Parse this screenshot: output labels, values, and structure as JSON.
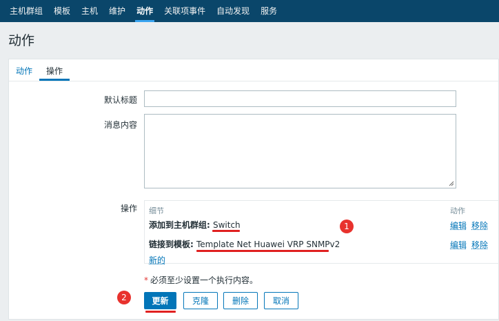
{
  "nav": {
    "items": [
      {
        "label": "主机群组",
        "active": false
      },
      {
        "label": "模板",
        "active": false
      },
      {
        "label": "主机",
        "active": false
      },
      {
        "label": "维护",
        "active": false
      },
      {
        "label": "动作",
        "active": true
      },
      {
        "label": "关联项事件",
        "active": false
      },
      {
        "label": "自动发现",
        "active": false
      },
      {
        "label": "服务",
        "active": false
      }
    ]
  },
  "page": {
    "title": "动作"
  },
  "tabs": [
    {
      "label": "动作",
      "active": false
    },
    {
      "label": "操作",
      "active": true
    }
  ],
  "form": {
    "default_subject_label": "默认标题",
    "default_subject_value": "",
    "message_label": "消息内容",
    "message_value": "",
    "operations_label": "操作"
  },
  "operations": {
    "col_details": "细节",
    "col_action": "动作",
    "rows": [
      {
        "prefix": "添加到主机群组: ",
        "value": "Switch",
        "edit": "编辑",
        "remove": "移除"
      },
      {
        "prefix": "链接到模板: ",
        "value": "Template Net Huawei VRP SNMPv2",
        "edit": "编辑",
        "remove": "移除"
      }
    ],
    "new_link": "新的"
  },
  "annotations": {
    "badge1": "1",
    "badge2": "2",
    "color": "#e02020"
  },
  "required_note": "必须至少设置一个执行内容。",
  "buttons": {
    "update": "更新",
    "clone": "克隆",
    "delete": "删除",
    "cancel": "取消"
  },
  "colors": {
    "nav_bg": "#0a466a",
    "accent": "#0275b8",
    "badge": "#e8322d"
  }
}
